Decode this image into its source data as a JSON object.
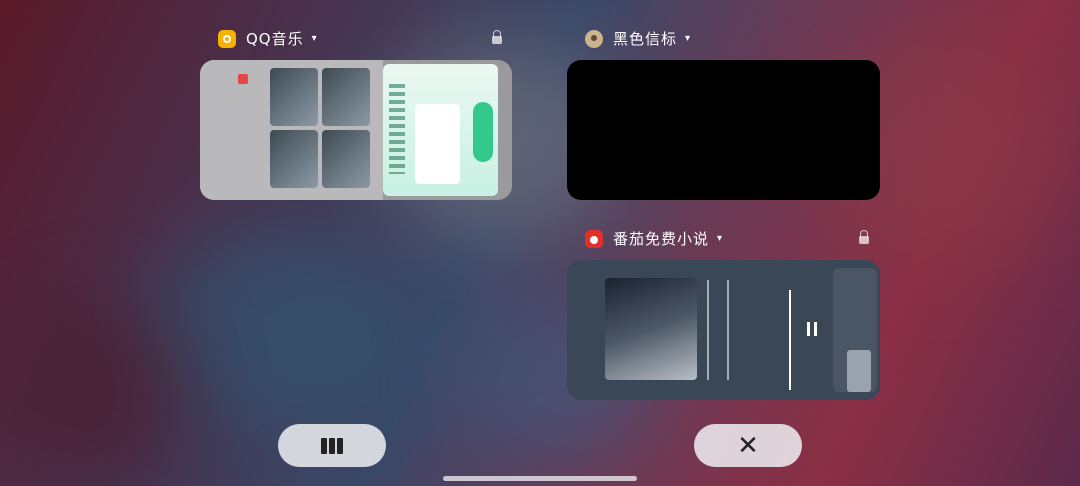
{
  "apps": {
    "qq": {
      "name": "QQ音乐",
      "caret": "▾"
    },
    "black": {
      "name": "黑色信标",
      "caret": "▾"
    },
    "novel": {
      "name": "番茄免费小说",
      "caret": "▾"
    }
  },
  "controls": {
    "close_symbol": "✕"
  },
  "colors": {
    "qq_icon": "#f5b200",
    "novel_icon": "#e0302c",
    "button_bg": "#f0f0f3"
  }
}
